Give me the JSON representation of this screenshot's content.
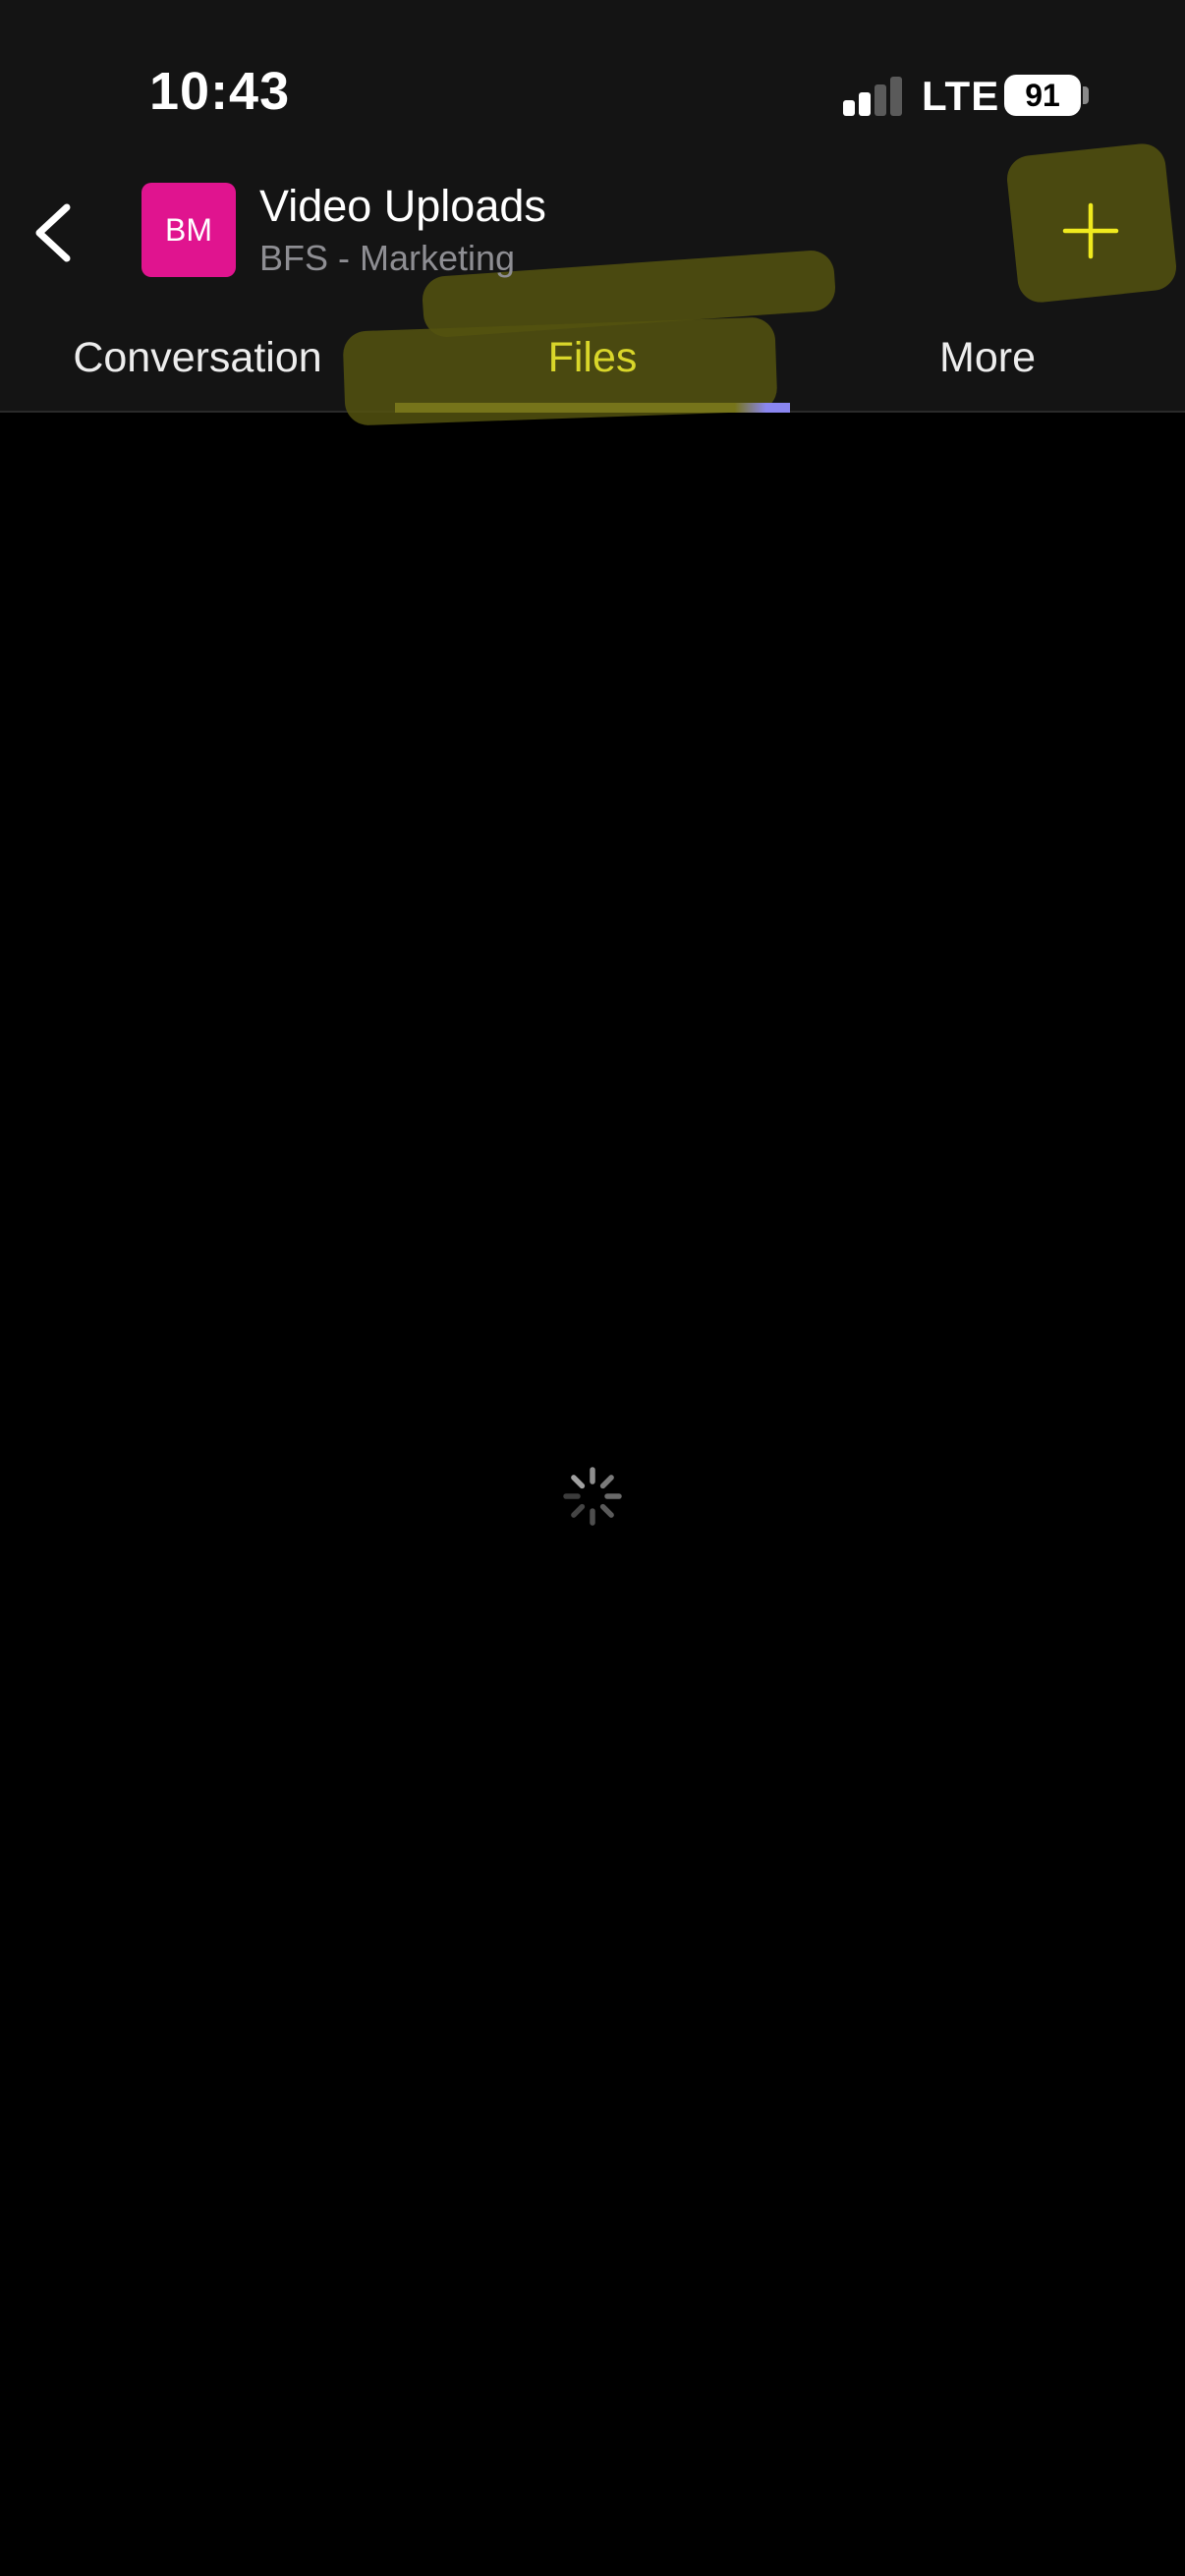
{
  "status_bar": {
    "time": "10:43",
    "network": "LTE",
    "battery": "91"
  },
  "header": {
    "avatar_initials": "BM",
    "title": "Video Uploads",
    "subtitle": "BFS - Marketing",
    "back_icon": "chevron-left-icon",
    "add_icon": "plus-icon"
  },
  "tabs": [
    {
      "label": "Conversation",
      "active": false
    },
    {
      "label": "Files",
      "active": true
    },
    {
      "label": "More",
      "active": false
    }
  ],
  "content": {
    "state_icon": "loading-spinner-icon"
  },
  "colors": {
    "background": "#000000",
    "chrome": "#141414",
    "avatar": "#e0148f",
    "accent": "#d9d62a",
    "highlight": "#54520f",
    "underline_end": "#8a86f0"
  }
}
